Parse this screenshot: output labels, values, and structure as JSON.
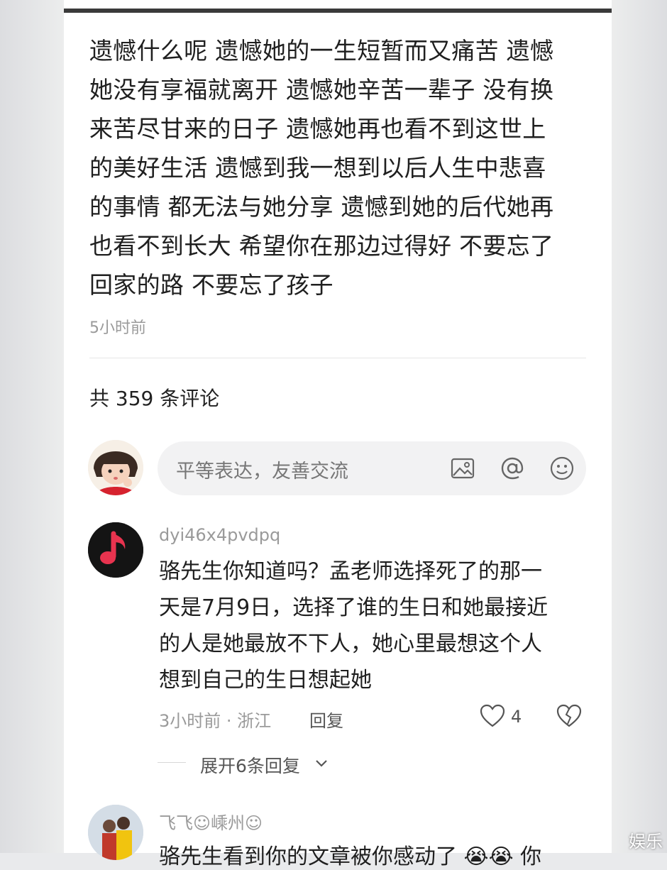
{
  "post": {
    "text": "遗憾什么呢 遗憾她的一生短暂而又痛苦 遗憾\n她没有享福就离开 遗憾她辛苦一辈子 没有换\n来苦尽甘来的日子 遗憾她再也看不到这世上\n的美好生活 遗憾到我一想到以后人生中悲喜\n的事情 都无法与她分享 遗憾到她的后代她再\n也看不到长大 希望你在那边过得好 不要忘了\n回家的路 不要忘了孩子",
    "time": "5小时前"
  },
  "comments_header": {
    "count_label": "共 359 条评论"
  },
  "composer": {
    "placeholder": "平等表达，友善交流",
    "icons": [
      "image-icon",
      "at-icon",
      "emoji-icon"
    ]
  },
  "comments": [
    {
      "user": "dyi46x4pvdpq",
      "avatar": "music-note-icon",
      "text": "骆先生你知道吗？孟老师选择死了的那一\n天是7月9日，选择了谁的生日和她最接近\n的人是她最放不下人，她心里最想这个人\n想到自己的生日想起她",
      "meta": "3小时前 · 浙江",
      "reply_label": "回复",
      "likes": "4",
      "expand_label": "展开6条回复"
    },
    {
      "user": "飞飞☺嵊州☺",
      "text": "骆先生看到你的文章被你感动了 😭😭 你"
    }
  ],
  "colors": {
    "accent_music": "#e8334f",
    "text": "#1f1f1f",
    "muted": "#9a9a9a"
  },
  "watermark": "娱乐"
}
